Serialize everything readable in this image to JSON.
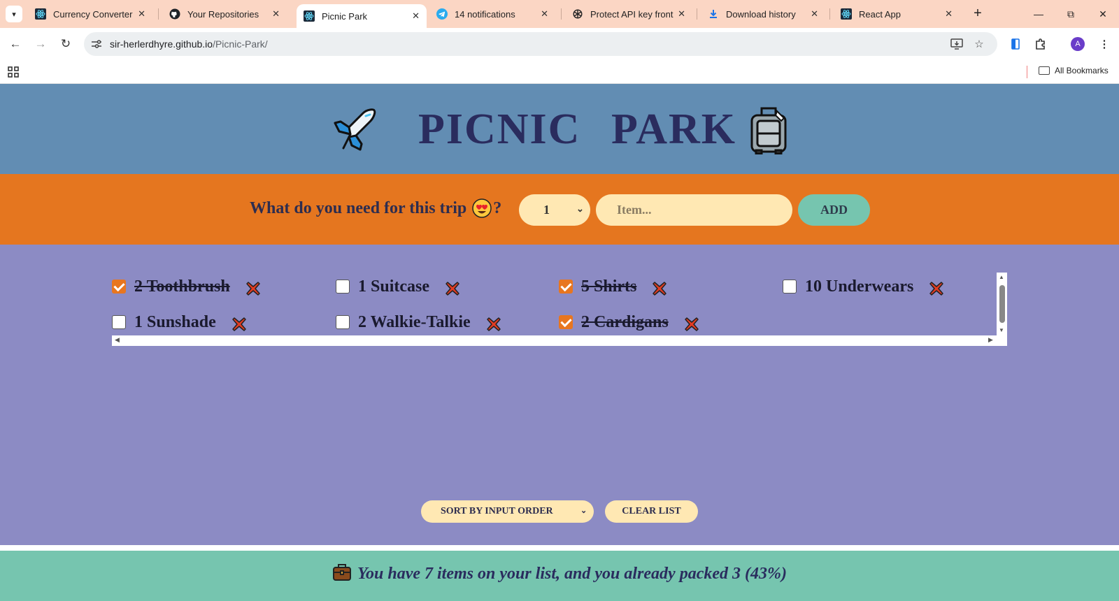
{
  "browser": {
    "tabs": [
      {
        "title": "Currency Converter",
        "icon": "react-icon"
      },
      {
        "title": "Your Repositories",
        "icon": "github-icon"
      },
      {
        "title": "Picnic Park",
        "icon": "react-icon",
        "active": true
      },
      {
        "title": "14 notifications",
        "icon": "telegram-icon"
      },
      {
        "title": "Protect API key fronter",
        "icon": "openai-icon"
      },
      {
        "title": "Download history",
        "icon": "download-icon"
      },
      {
        "title": "React App",
        "icon": "react-icon"
      }
    ],
    "url_host": "sir-herlerdhyre.github.io",
    "url_path": "/Picnic-Park/",
    "profile_initial": "A",
    "bookmarks_label": "All Bookmarks"
  },
  "app": {
    "title": "PICNIC PARK",
    "question_prefix": "What do you need for this trip",
    "question_suffix": "?",
    "quantity_value": "1",
    "item_placeholder": "Item...",
    "add_label": "ADD",
    "items": [
      {
        "label": "2 Toothbrush",
        "packed": true
      },
      {
        "label": "1 Suitcase",
        "packed": false
      },
      {
        "label": "5 Shirts",
        "packed": true
      },
      {
        "label": "10 Underwears",
        "packed": false
      },
      {
        "label": "1 Sunshade",
        "packed": false
      },
      {
        "label": "2 Walkie-Talkie",
        "packed": false
      },
      {
        "label": "2 Cardigans",
        "packed": true
      }
    ],
    "sort_value": "SORT BY INPUT ORDER",
    "clear_label": "CLEAR LIST",
    "stats_text": "You have 7 items on your list, and you already packed 3 (43%)"
  },
  "colors": {
    "header": "#628db3",
    "form": "#e5761f",
    "list": "#8c8bc4",
    "footer": "#76c5af",
    "input": "#ffe8b3",
    "accent": "#e8761f",
    "title": "#2a2c5e"
  }
}
